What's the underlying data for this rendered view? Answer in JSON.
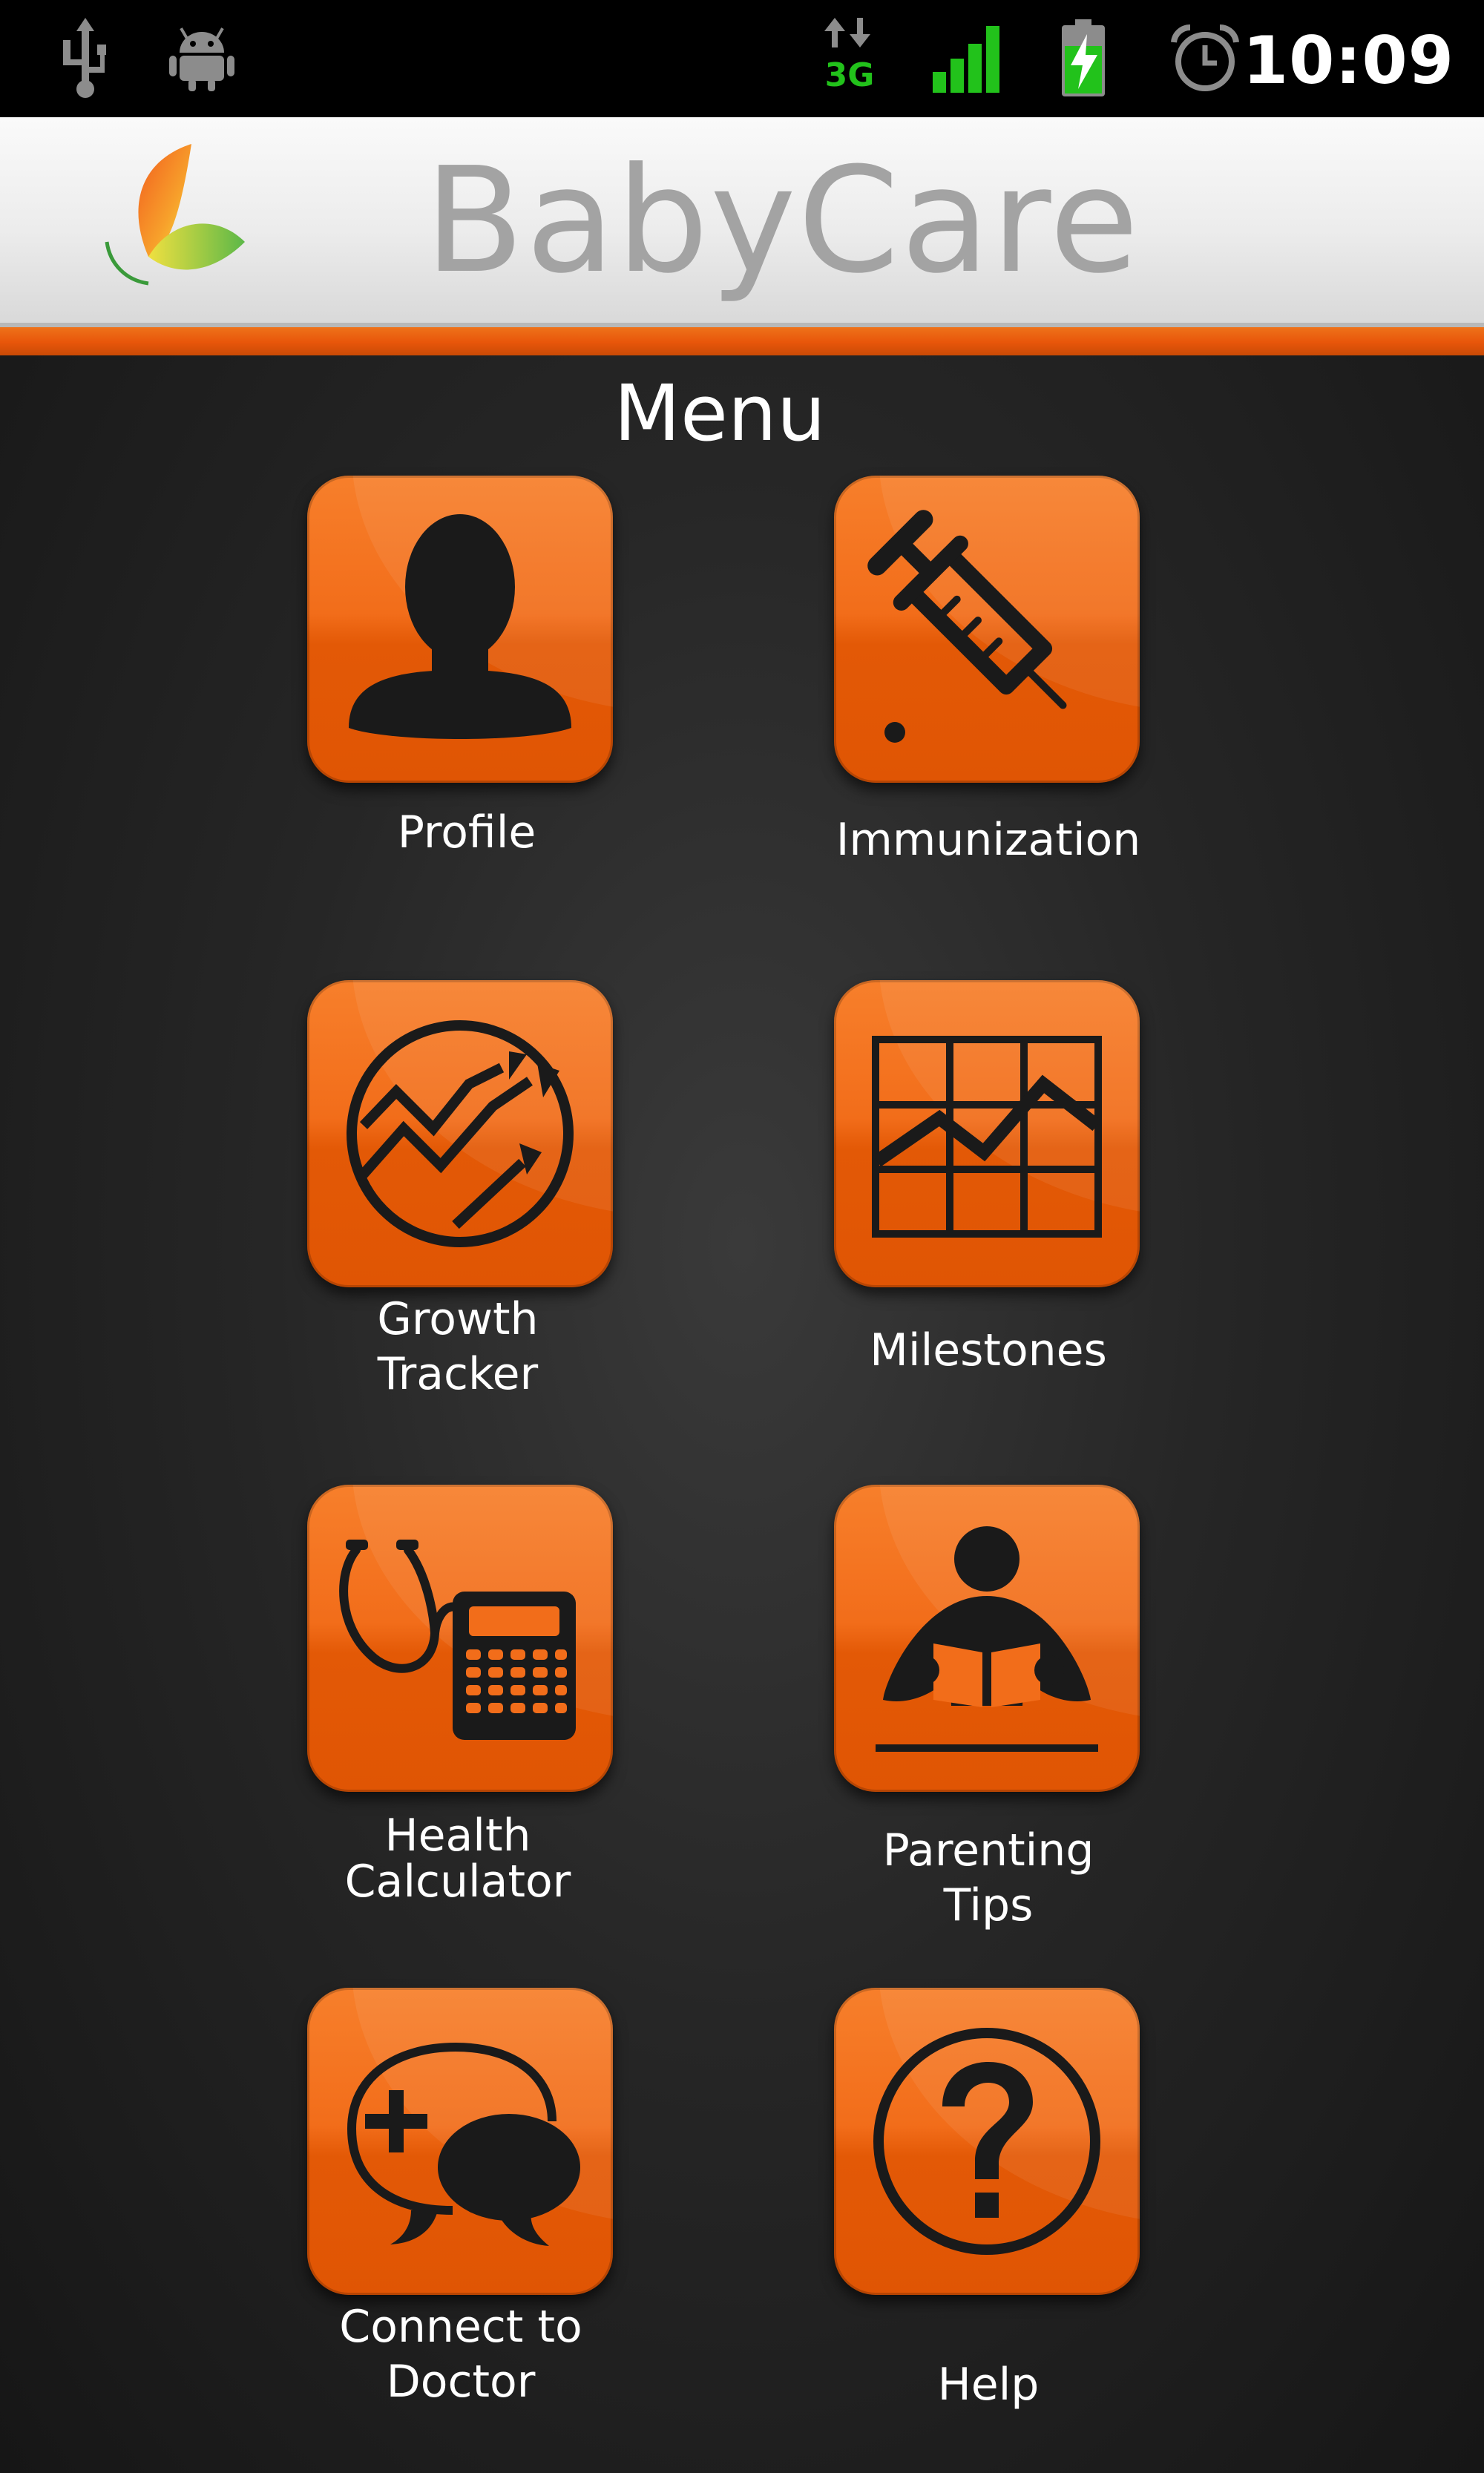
{
  "status_bar": {
    "time": "10:09",
    "icons": [
      "usb-icon",
      "android-debug-icon",
      "data-3g-icon",
      "signal-icon",
      "battery-charging-icon",
      "alarm-icon"
    ],
    "network_type": "3G",
    "colors": {
      "accent_green": "#22c21b",
      "background": "#000000"
    }
  },
  "header": {
    "app_title": "BabyCare",
    "logo_icon": "butterfly-logo-icon",
    "colors": {
      "title": "#a3a3a3",
      "stripe": "#e8560a"
    }
  },
  "menu": {
    "title": "Menu",
    "tile_color": "#f26d1a",
    "items": [
      {
        "label": "Profile",
        "icon": "profile-icon"
      },
      {
        "label": "Immunization",
        "icon": "syringe-icon"
      },
      {
        "label": "Growth\nTracker",
        "icon": "growth-chart-icon"
      },
      {
        "label": "Milestones",
        "icon": "milestones-grid-icon"
      },
      {
        "label": "Health\nCalculator",
        "icon": "stethoscope-calculator-icon"
      },
      {
        "label": "Parenting Tips",
        "icon": "reading-person-icon"
      },
      {
        "label": "Connect to\nDoctor",
        "icon": "doctor-chat-icon"
      },
      {
        "label": "Help",
        "icon": "help-icon"
      }
    ]
  }
}
